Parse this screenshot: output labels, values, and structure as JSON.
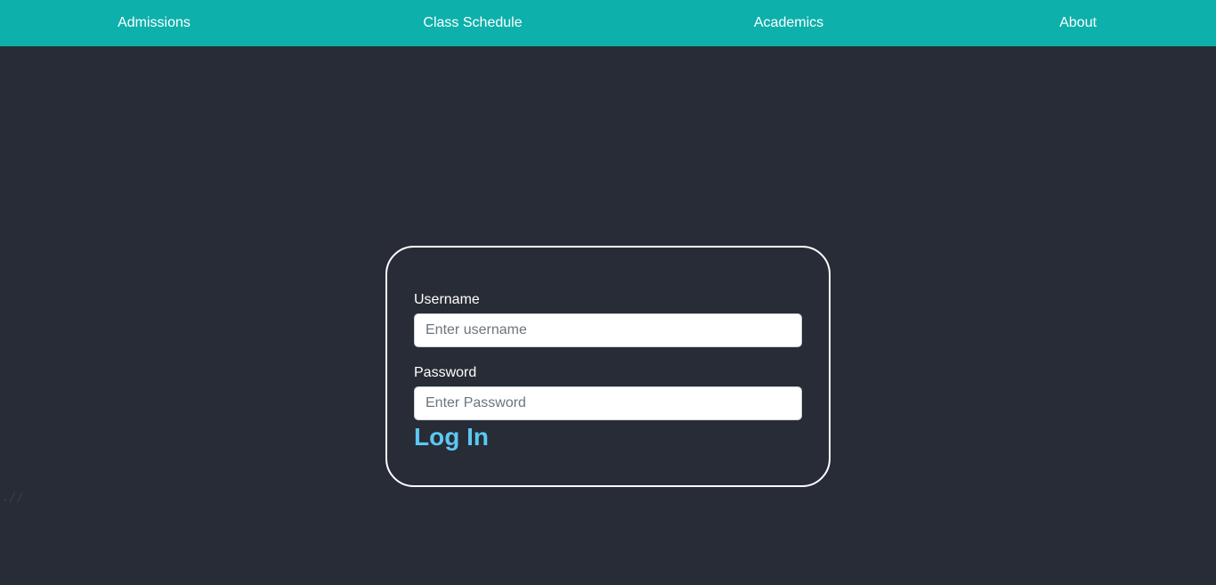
{
  "nav": {
    "items": [
      {
        "label": "Admissions"
      },
      {
        "label": "Class Schedule"
      },
      {
        "label": "Academics"
      },
      {
        "label": "About"
      }
    ]
  },
  "login": {
    "username_label": "Username",
    "username_placeholder": "Enter username",
    "username_value": "",
    "password_label": "Password",
    "password_placeholder": "Enter Password",
    "password_value": "",
    "submit_label": "Log In"
  },
  "colors": {
    "navbar": "#0db0ab",
    "background": "#282c36",
    "accent": "#5bc8f2",
    "card_border": "#ffffff"
  },
  "icons": {
    "corner_mark": "resize-grip-icon"
  }
}
